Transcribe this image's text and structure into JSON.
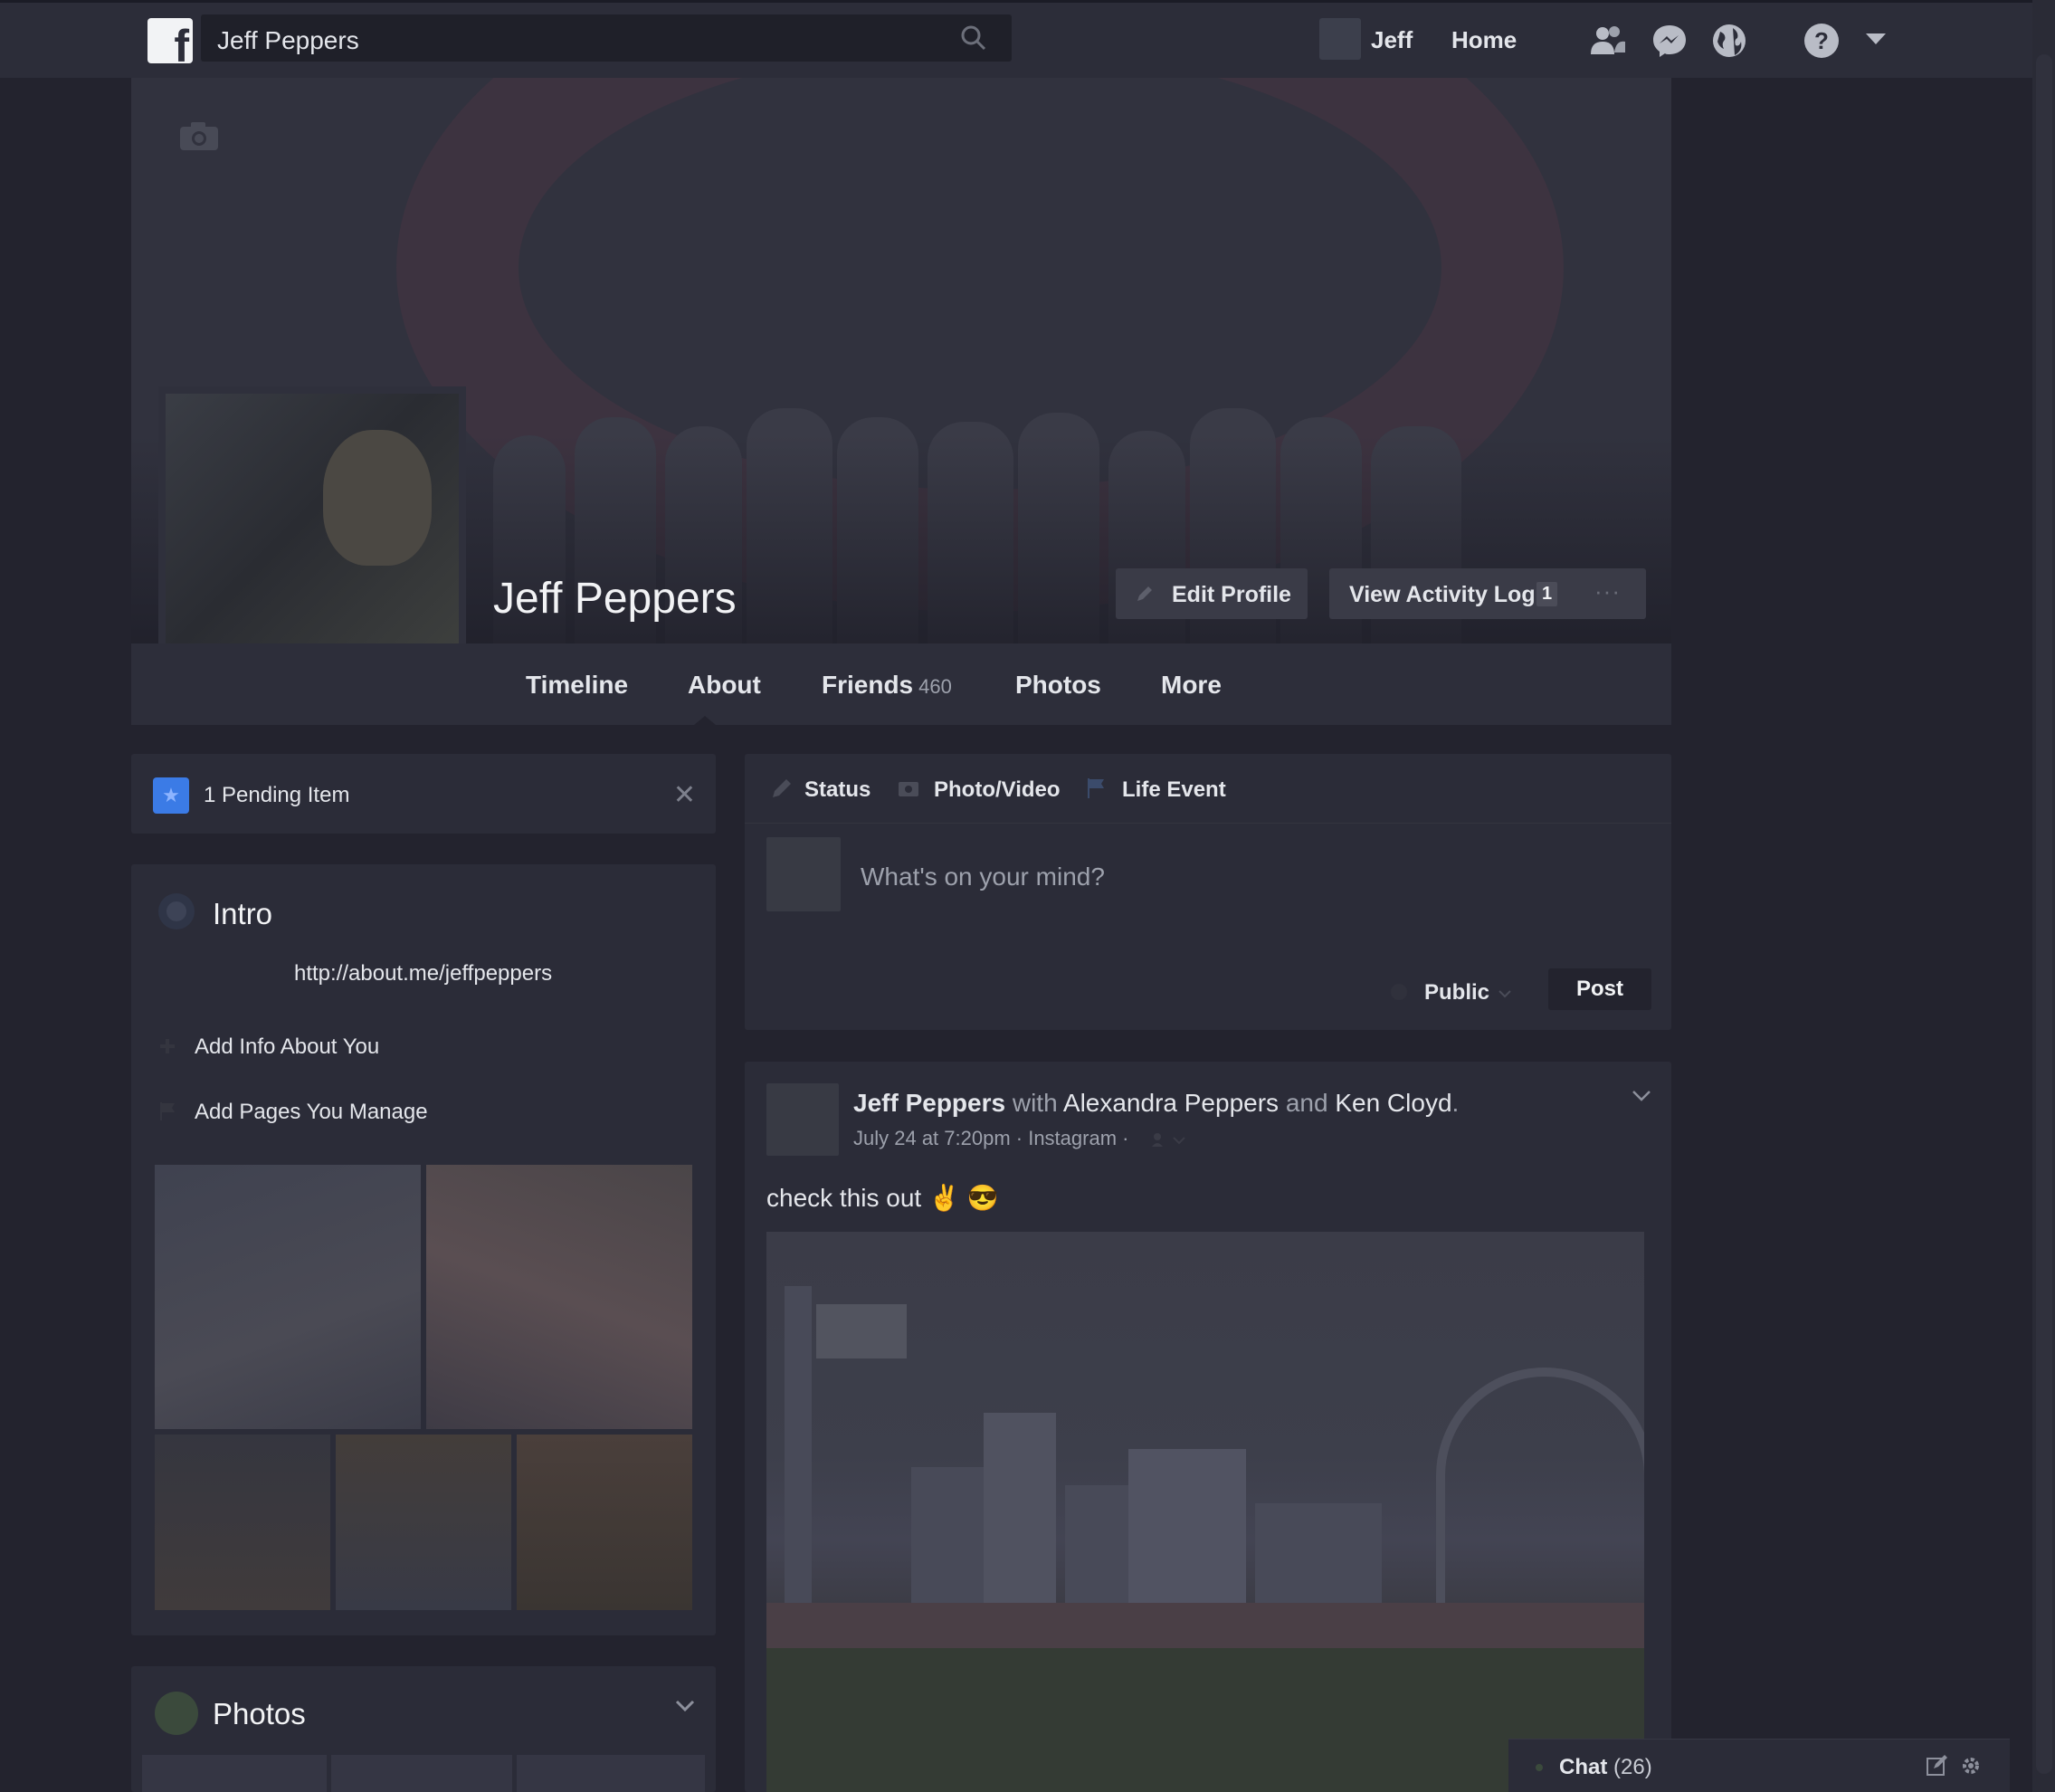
{
  "header": {
    "search_value": "Jeff Peppers",
    "user_name": "Jeff",
    "home_label": "Home",
    "logo_letter": "f"
  },
  "profile": {
    "name": "Jeff Peppers",
    "edit_profile_label": "Edit Profile",
    "view_activity_label": "View Activity Log",
    "activity_badge": "1",
    "more_dots": "···"
  },
  "tabs": [
    {
      "label": "Timeline"
    },
    {
      "label": "About"
    },
    {
      "label": "Friends",
      "count": "460"
    },
    {
      "label": "Photos"
    },
    {
      "label": "More"
    }
  ],
  "pending": {
    "label": "1 Pending Item",
    "close": "✕",
    "star": "★"
  },
  "intro": {
    "title": "Intro",
    "link": "http://about.me/jeffpeppers",
    "add_info": "Add Info About You",
    "add_pages": "Add Pages You Manage"
  },
  "photos_section": {
    "title": "Photos"
  },
  "composer": {
    "tabs": [
      "Status",
      "Photo/Video",
      "Life Event"
    ],
    "placeholder": "What's on your mind?",
    "audience": "Public",
    "post_label": "Post"
  },
  "post": {
    "author": "Jeff Peppers",
    "with_word": " with ",
    "tag1": "Alexandra Peppers",
    "and_word": " and ",
    "tag2": "Ken Cloyd",
    "period": ".",
    "meta": "July 24 at 7:20pm · Instagram ·",
    "message": "check this out",
    "emoji": "✌ 😎"
  },
  "chat": {
    "label": "Chat",
    "count": "(26)"
  },
  "colors": {
    "background": "#23232e",
    "card": "#2b2c38",
    "accent_blue": "#3b7be6",
    "text": "#e4e6eb",
    "muted": "#9da1ac"
  },
  "icons": [
    "facebook-logo",
    "search-icon",
    "friends-icon",
    "messenger-icon",
    "globe-icon",
    "help-icon",
    "dropdown-arrow-icon",
    "camera-icon",
    "pencil-icon",
    "star-icon",
    "close-icon",
    "globe-icon",
    "plus-icon",
    "flag-icon",
    "chevron-down-icon",
    "compose-icon",
    "gear-icon"
  ]
}
